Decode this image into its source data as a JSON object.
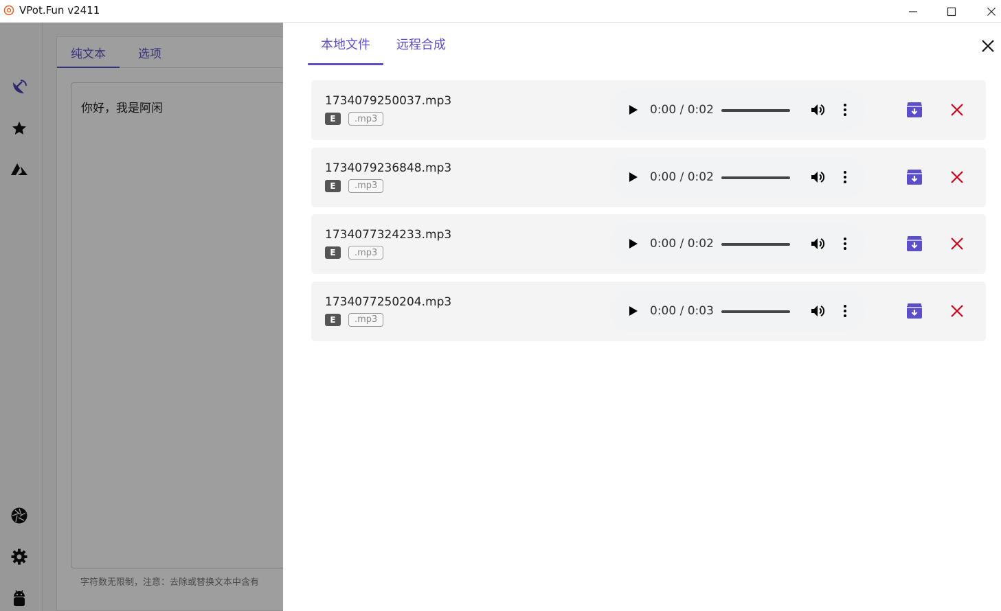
{
  "window": {
    "title": "VPot.Fun v2411",
    "logo_icon": "app-logo-icon",
    "minimize_icon": "minimize-icon",
    "maximize_icon": "maximize-icon",
    "close_icon": "close-icon"
  },
  "sidebar": {
    "items": [
      {
        "icon": "satellite-dish-icon"
      },
      {
        "icon": "star-icon"
      },
      {
        "icon": "mountain-icon"
      },
      {
        "icon": "aperture-icon"
      },
      {
        "icon": "gear-icon"
      },
      {
        "icon": "android-icon"
      }
    ]
  },
  "editor": {
    "tabs": [
      "纯文本",
      "选项"
    ],
    "active_tab": "纯文本",
    "text_value": "你好，我是阿闲",
    "hint": "字符数无限制，注意：去除或替换文本中含有"
  },
  "drawer": {
    "tabs": [
      "本地文件",
      "远程合成"
    ],
    "active_tab": "本地文件",
    "close_icon": "close-icon",
    "files": [
      {
        "name": "1734079250037.mp3",
        "badge": "E",
        "ext": ".mp3",
        "time": "0:00 / 0:02",
        "progress": 0
      },
      {
        "name": "1734079236848.mp3",
        "badge": "E",
        "ext": ".mp3",
        "time": "0:00 / 0:02",
        "progress": 0
      },
      {
        "name": "1734077324233.mp3",
        "badge": "E",
        "ext": ".mp3",
        "time": "0:00 / 0:02",
        "progress": 0
      },
      {
        "name": "1734077250204.mp3",
        "badge": "E",
        "ext": ".mp3",
        "time": "0:00 / 0:03",
        "progress": 0
      }
    ]
  },
  "colors": {
    "accent": "#5b4fc9",
    "delete": "#d0021b",
    "card_bg": "#f4f4f5"
  }
}
